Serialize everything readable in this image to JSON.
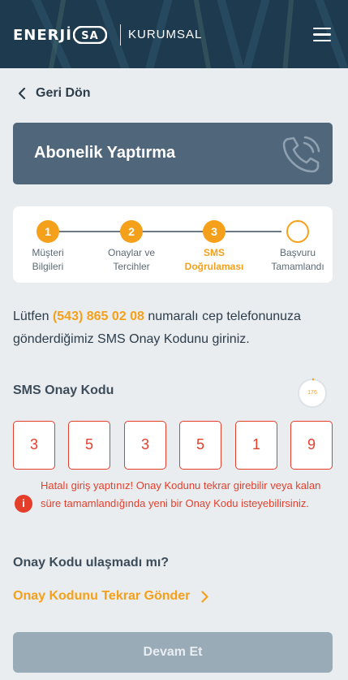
{
  "header": {
    "logo_text_left": "ENERJİ",
    "logo_text_right": "SA",
    "section": "KURUMSAL",
    "menu_icon": "hamburger-menu-icon",
    "bg_color": "#1e3a4f"
  },
  "nav": {
    "back_label": "Geri Dön"
  },
  "banner": {
    "title": "Abonelik Yaptırma",
    "icon": "phone-call-icon",
    "bg_color": "#50667a"
  },
  "stepper": {
    "steps": [
      {
        "number": "1",
        "line1": "Müşteri",
        "line2": "Bilgileri",
        "state": "done"
      },
      {
        "number": "2",
        "line1": "Onaylar ve",
        "line2": "Tercihler",
        "state": "done"
      },
      {
        "number": "3",
        "line1": "SMS",
        "line2": "Doğrulaması",
        "state": "active"
      },
      {
        "number": "",
        "line1": "Başvuru",
        "line2": "Tamamlandı",
        "state": "pending"
      }
    ],
    "accent_color": "#f5a01a"
  },
  "instruction": {
    "prefix": "Lütfen",
    "phone": "(543) 865 02 08",
    "suffix": "numaralı cep telefonunuza gönderdiğimiz SMS Onay Kodunu giriniz."
  },
  "sms": {
    "label": "SMS Onay Kodu",
    "timer_value": "176",
    "digits": [
      "3",
      "5",
      "3",
      "5",
      "1",
      "9"
    ]
  },
  "error": {
    "icon": "error-info-icon",
    "message": "Hatalı giriş yaptınız! Onay Kodunu tekrar girebilir veya kalan süre tamamlandığında yeni bir Onay Kodu isteyebilirsiniz.",
    "color": "#e53e2b"
  },
  "resend": {
    "question": "Onay Kodu ulaşmadı mı?",
    "link_label": "Onay Kodunu Tekrar Gönder"
  },
  "footer": {
    "submit_label": "Devam Et"
  }
}
